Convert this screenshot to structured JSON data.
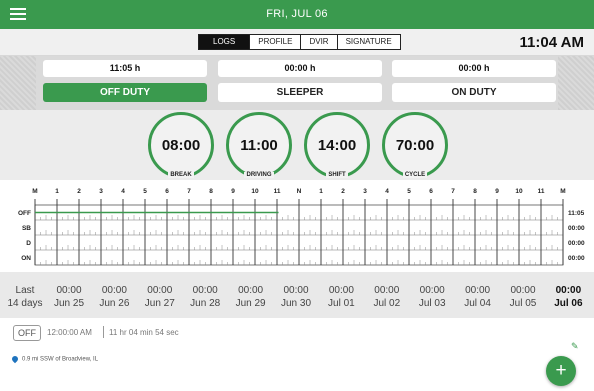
{
  "header": {
    "date": "FRI, JUL 06"
  },
  "tabs": [
    {
      "label": "LOGS",
      "active": true
    },
    {
      "label": "PROFILE",
      "active": false
    },
    {
      "label": "DVIR",
      "active": false
    },
    {
      "label": "SIGNATURE",
      "active": false
    }
  ],
  "clock": "11:04 AM",
  "duty": {
    "off_duty": {
      "time": "11:05 h",
      "label": "OFF DUTY",
      "active": true
    },
    "sleeper": {
      "time": "00:00 h",
      "label": "SLEEPER"
    },
    "on_duty": {
      "time": "00:00 h",
      "label": "ON DUTY"
    }
  },
  "gauges": [
    {
      "value": "08:00",
      "label": "BREAK"
    },
    {
      "value": "11:00",
      "label": "DRIVING"
    },
    {
      "value": "14:00",
      "label": "SHIFT"
    },
    {
      "value": "70:00",
      "label": "CYCLE"
    }
  ],
  "log_grid": {
    "hour_labels": [
      "M",
      "1",
      "2",
      "3",
      "4",
      "5",
      "6",
      "7",
      "8",
      "9",
      "10",
      "11",
      "N",
      "1",
      "2",
      "3",
      "4",
      "5",
      "6",
      "7",
      "8",
      "9",
      "10",
      "11",
      "M"
    ],
    "rows": [
      {
        "label": "OFF",
        "total": "11:05"
      },
      {
        "label": "SB",
        "total": "00:00"
      },
      {
        "label": "D",
        "total": "00:00"
      },
      {
        "label": "ON",
        "total": "00:00"
      }
    ],
    "off_duty_until_hour": 11.07,
    "line_color": "#3a9a4e"
  },
  "history": {
    "label_line1": "Last",
    "label_line2": "14 days",
    "days": [
      {
        "time": "00:00",
        "date": "Jun 25"
      },
      {
        "time": "00:00",
        "date": "Jun 26"
      },
      {
        "time": "00:00",
        "date": "Jun 27"
      },
      {
        "time": "00:00",
        "date": "Jun 28"
      },
      {
        "time": "00:00",
        "date": "Jun 29"
      },
      {
        "time": "00:00",
        "date": "Jun 30"
      },
      {
        "time": "00:00",
        "date": "Jul 01"
      },
      {
        "time": "00:00",
        "date": "Jul 02"
      },
      {
        "time": "00:00",
        "date": "Jul 03"
      },
      {
        "time": "00:00",
        "date": "Jul 04"
      },
      {
        "time": "00:00",
        "date": "Jul 05"
      },
      {
        "time": "00:00",
        "date": "Jul 06",
        "current": true
      }
    ]
  },
  "event": {
    "status": "OFF",
    "start_time": "12:00:00 AM",
    "duration": "11 hr 04 min 54 sec",
    "location": "0.9 mi SSW of Broadview, IL"
  },
  "fab_label": "+",
  "colors": {
    "accent": "#3a9a4e",
    "location_pin": "#1e73be"
  }
}
